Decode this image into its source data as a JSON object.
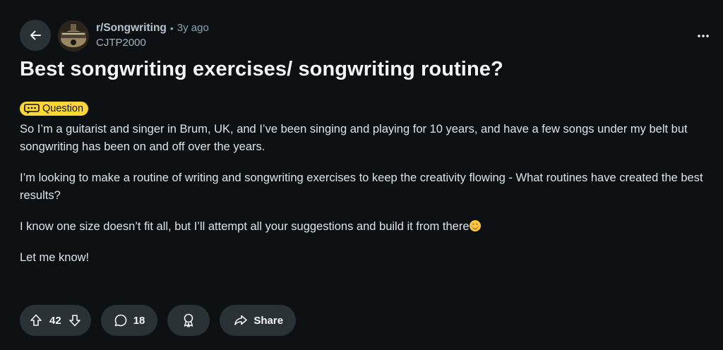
{
  "post": {
    "subreddit": "r/Songwriting",
    "separator": "•",
    "time_ago": "3y ago",
    "author": "CJTP2000",
    "title": "Best songwriting exercises/ songwriting routine?",
    "flair": "Question",
    "paragraphs": [
      "So I’m a guitarist and singer in Brum, UK, and I’ve been singing and playing for 10 years, and have a few songs under my belt but songwriting has been on and off over the years.",
      "I’m looking to make a routine of writing and songwriting exercises to keep the creativity flowing - What routines have created the best results?",
      "I know one size doesn’t fit all, but I’ll attempt all your suggestions and build it from there",
      "Let me know!"
    ]
  },
  "actions": {
    "vote_count": "42",
    "comment_count": "18",
    "share_label": "Share"
  },
  "icons": {
    "back": "arrow-left-icon",
    "more": "ellipsis-icon",
    "flair": "chat-bubble-icon",
    "upvote": "arrow-up-icon",
    "downvote": "arrow-down-icon",
    "comment": "speech-bubble-icon",
    "award": "award-icon",
    "share": "share-arrow-icon",
    "emoji": "smiling-face-icon"
  },
  "colors": {
    "background": "#0e1113",
    "pill": "#2a3236",
    "flair": "#ffd635",
    "text": "#f2f4f5",
    "muted": "#8ba2ad"
  }
}
